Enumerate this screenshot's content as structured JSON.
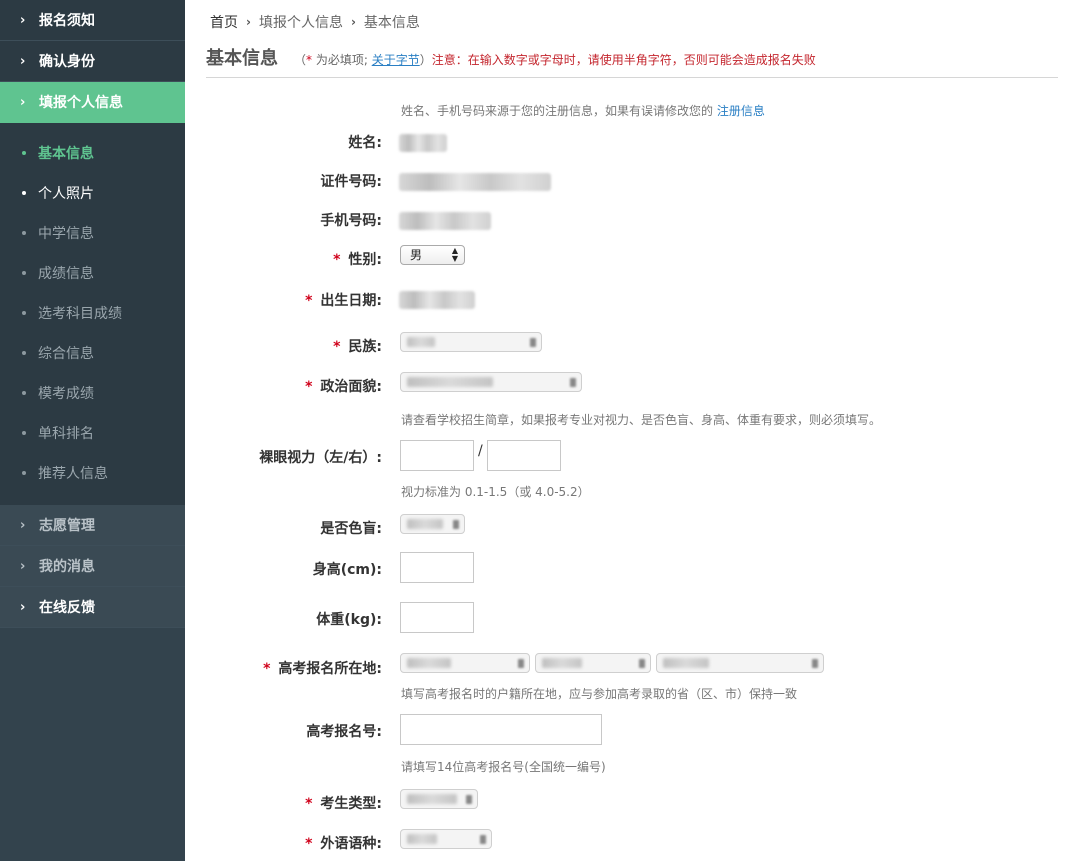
{
  "sidebar": {
    "top": [
      {
        "label": "报名须知"
      },
      {
        "label": "确认身份"
      },
      {
        "label": "填报个人信息"
      }
    ],
    "sub": [
      {
        "label": "基本信息"
      },
      {
        "label": "个人照片"
      },
      {
        "label": "中学信息"
      },
      {
        "label": "成绩信息"
      },
      {
        "label": "选考科目成绩"
      },
      {
        "label": "综合信息"
      },
      {
        "label": "模考成绩"
      },
      {
        "label": "单科排名"
      },
      {
        "label": "推荐人信息"
      }
    ],
    "bottom": [
      {
        "label": "志愿管理"
      },
      {
        "label": "我的消息"
      },
      {
        "label": "在线反馈"
      }
    ]
  },
  "breadcrumb": {
    "home": "首页",
    "level1": "填报个人信息",
    "level2": "基本信息"
  },
  "page": {
    "title": "基本信息",
    "hint_open": "（",
    "hint_star": "*",
    "hint_required": " 为必填项;  ",
    "hint_link": "关于字节",
    "hint_close": "）",
    "hint_warning": "注意：在输入数字或字母时，请使用半角字符，否则可能会造成报名失败"
  },
  "form": {
    "intro_note": "姓名、手机号码来源于您的注册信息，如果有误请修改您的 ",
    "intro_link": "注册信息",
    "name_label": "姓名:",
    "id_label": "证件号码:",
    "phone_label": "手机号码:",
    "gender_label": "性别:",
    "gender_value": "男",
    "birth_label": "出生日期:",
    "ethnicity_label": "民族:",
    "political_label": "政治面貌:",
    "health_note": "请查看学校招生简章，如果报考专业对视力、是否色盲、身高、体重有要求，则必须填写。",
    "vision_label": "裸眼视力（左/右）:",
    "vision_sep": "/",
    "vision_note": "视力标准为 0.1-1.5（或 4.0-5.2）",
    "colorblind_label": "是否色盲:",
    "height_label": "身高(cm):",
    "weight_label": "体重(kg):",
    "location_label": "高考报名所在地:",
    "location_note": "填写高考报名时的户籍所在地，应与参加高考录取的省（区、市）保持一致",
    "regno_label": "高考报名号:",
    "regno_note": "请填写14位高考报名号(全国统一编号)",
    "type_label": "考生类型:",
    "language_label": "外语语种:",
    "req_mark": "*"
  }
}
